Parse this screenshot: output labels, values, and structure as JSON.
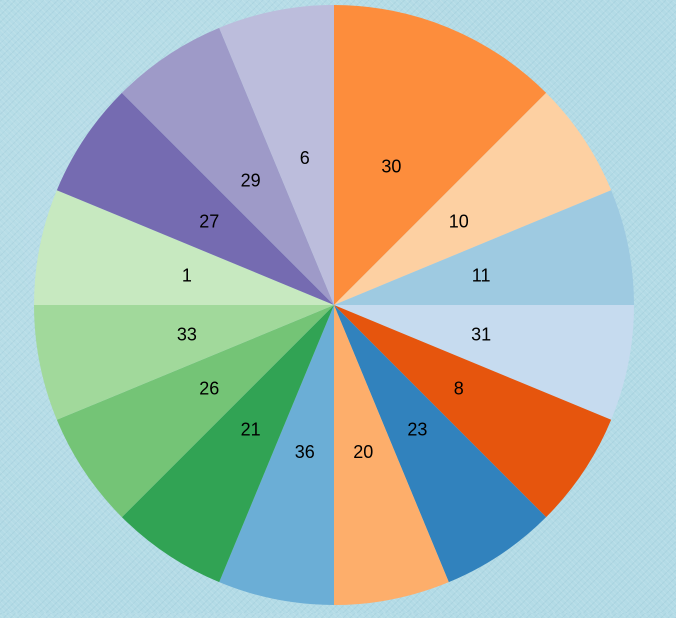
{
  "chart_data": {
    "type": "pie",
    "start": "12 o'clock",
    "direction": "clockwise",
    "slices": [
      {
        "label": "30",
        "value": 2,
        "color": "#fd8d3c"
      },
      {
        "label": "10",
        "value": 1,
        "color": "#fdd0a2"
      },
      {
        "label": "11",
        "value": 1,
        "color": "#9ecae1"
      },
      {
        "label": "31",
        "value": 1,
        "color": "#c6dbef"
      },
      {
        "label": "8",
        "value": 1,
        "color": "#e6550d"
      },
      {
        "label": "23",
        "value": 1,
        "color": "#3182bd"
      },
      {
        "label": "20",
        "value": 1,
        "color": "#fdae6b"
      },
      {
        "label": "36",
        "value": 1,
        "color": "#6baed6"
      },
      {
        "label": "21",
        "value": 1,
        "color": "#31a354"
      },
      {
        "label": "26",
        "value": 1,
        "color": "#74c476"
      },
      {
        "label": "33",
        "value": 1,
        "color": "#a1d99b"
      },
      {
        "label": "1",
        "value": 1,
        "color": "#c7e9c0"
      },
      {
        "label": "27",
        "value": 1,
        "color": "#756bb1"
      },
      {
        "label": "29",
        "value": 1,
        "color": "#9e9ac8"
      },
      {
        "label": "6",
        "value": 1,
        "color": "#bcbddc"
      }
    ]
  }
}
